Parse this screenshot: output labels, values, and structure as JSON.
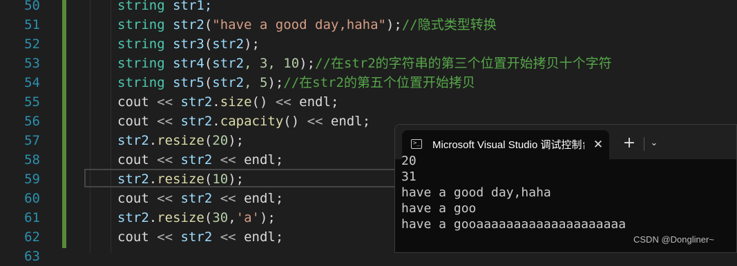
{
  "editor": {
    "line_numbers": [
      "50",
      "51",
      "52",
      "53",
      "54",
      "55",
      "56",
      "57",
      "58",
      "59",
      "60",
      "61",
      "62",
      "63"
    ],
    "lines": [
      {
        "kw": "string",
        "rest": " str1;"
      },
      {
        "kw": "string",
        "var": " str2",
        "open": "(",
        "str": "\"have a good day,haha\"",
        "close": ");",
        "cmt": "//隐式类型转换"
      },
      {
        "kw": "string",
        "var": " str3",
        "open": "(",
        "arg": "str2",
        "close": ");"
      },
      {
        "kw": "string",
        "var": " str4",
        "open": "(",
        "arg": "str2",
        "n1": ", 3, ",
        "n2": "10",
        "close": ");",
        "cmt": "//在str2的字符串的第三个位置开始拷贝十个字符"
      },
      {
        "kw": "string",
        "var": " str5",
        "open": "(",
        "arg": "str2",
        "n1": ", ",
        "n2": "5",
        "close": ");",
        "cmt": "//在str2的第五个位置开始拷贝"
      },
      {
        "a": "cout",
        "op": " << ",
        "b": "str2",
        "dot": ".",
        "fn": "size",
        "call": "()",
        "op2": " << ",
        "c": "endl",
        "end": ";"
      },
      {
        "a": "cout",
        "op": " << ",
        "b": "str2",
        "dot": ".",
        "fn": "capacity",
        "call": "()",
        "op2": " << ",
        "c": "endl",
        "end": ";"
      },
      {
        "b": "str2",
        "dot": ".",
        "fn": "resize",
        "open": "(",
        "num": "20",
        "close": ");"
      },
      {
        "a": "cout",
        "op": " << ",
        "b": "str2",
        "op2": " << ",
        "c": "endl",
        "end": ";"
      },
      {
        "b": "str2",
        "dot": ".",
        "fn": "resize",
        "open": "(",
        "num": "10",
        "close": ");"
      },
      {
        "a": "cout",
        "op": " << ",
        "b": "str2",
        "op2": " << ",
        "c": "endl",
        "end": ";"
      },
      {
        "b": "str2",
        "dot": ".",
        "fn": "resize",
        "open": "(",
        "num": "30",
        "comma": ",",
        "str": "'a'",
        "close": ");"
      },
      {
        "a": "cout",
        "op": " << ",
        "b": "str2",
        "op2": " << ",
        "c": "endl",
        "end": ";"
      }
    ]
  },
  "terminal": {
    "tab_title": "Microsoft Visual Studio 调试控制台",
    "close_glyph": "✕",
    "new_tab_glyph": "+",
    "dropdown_glyph": "⌄",
    "output_lines": [
      "20",
      "31",
      "have a good day,haha",
      "have a goo",
      "have a gooaaaaaaaaaaaaaaaaaaaa"
    ]
  },
  "watermark": "CSDN @Dongliner~",
  "colors": {
    "background": "#1e1e1e",
    "line_number": "#2b91af",
    "type": "#4ec9b0",
    "identifier": "#9cdcfe",
    "function": "#dcdcaa",
    "string": "#d69d85",
    "comment": "#57a64a",
    "number": "#b5cea8",
    "change_bar": "#578a3b",
    "terminal_bg": "#0c0c0c"
  }
}
